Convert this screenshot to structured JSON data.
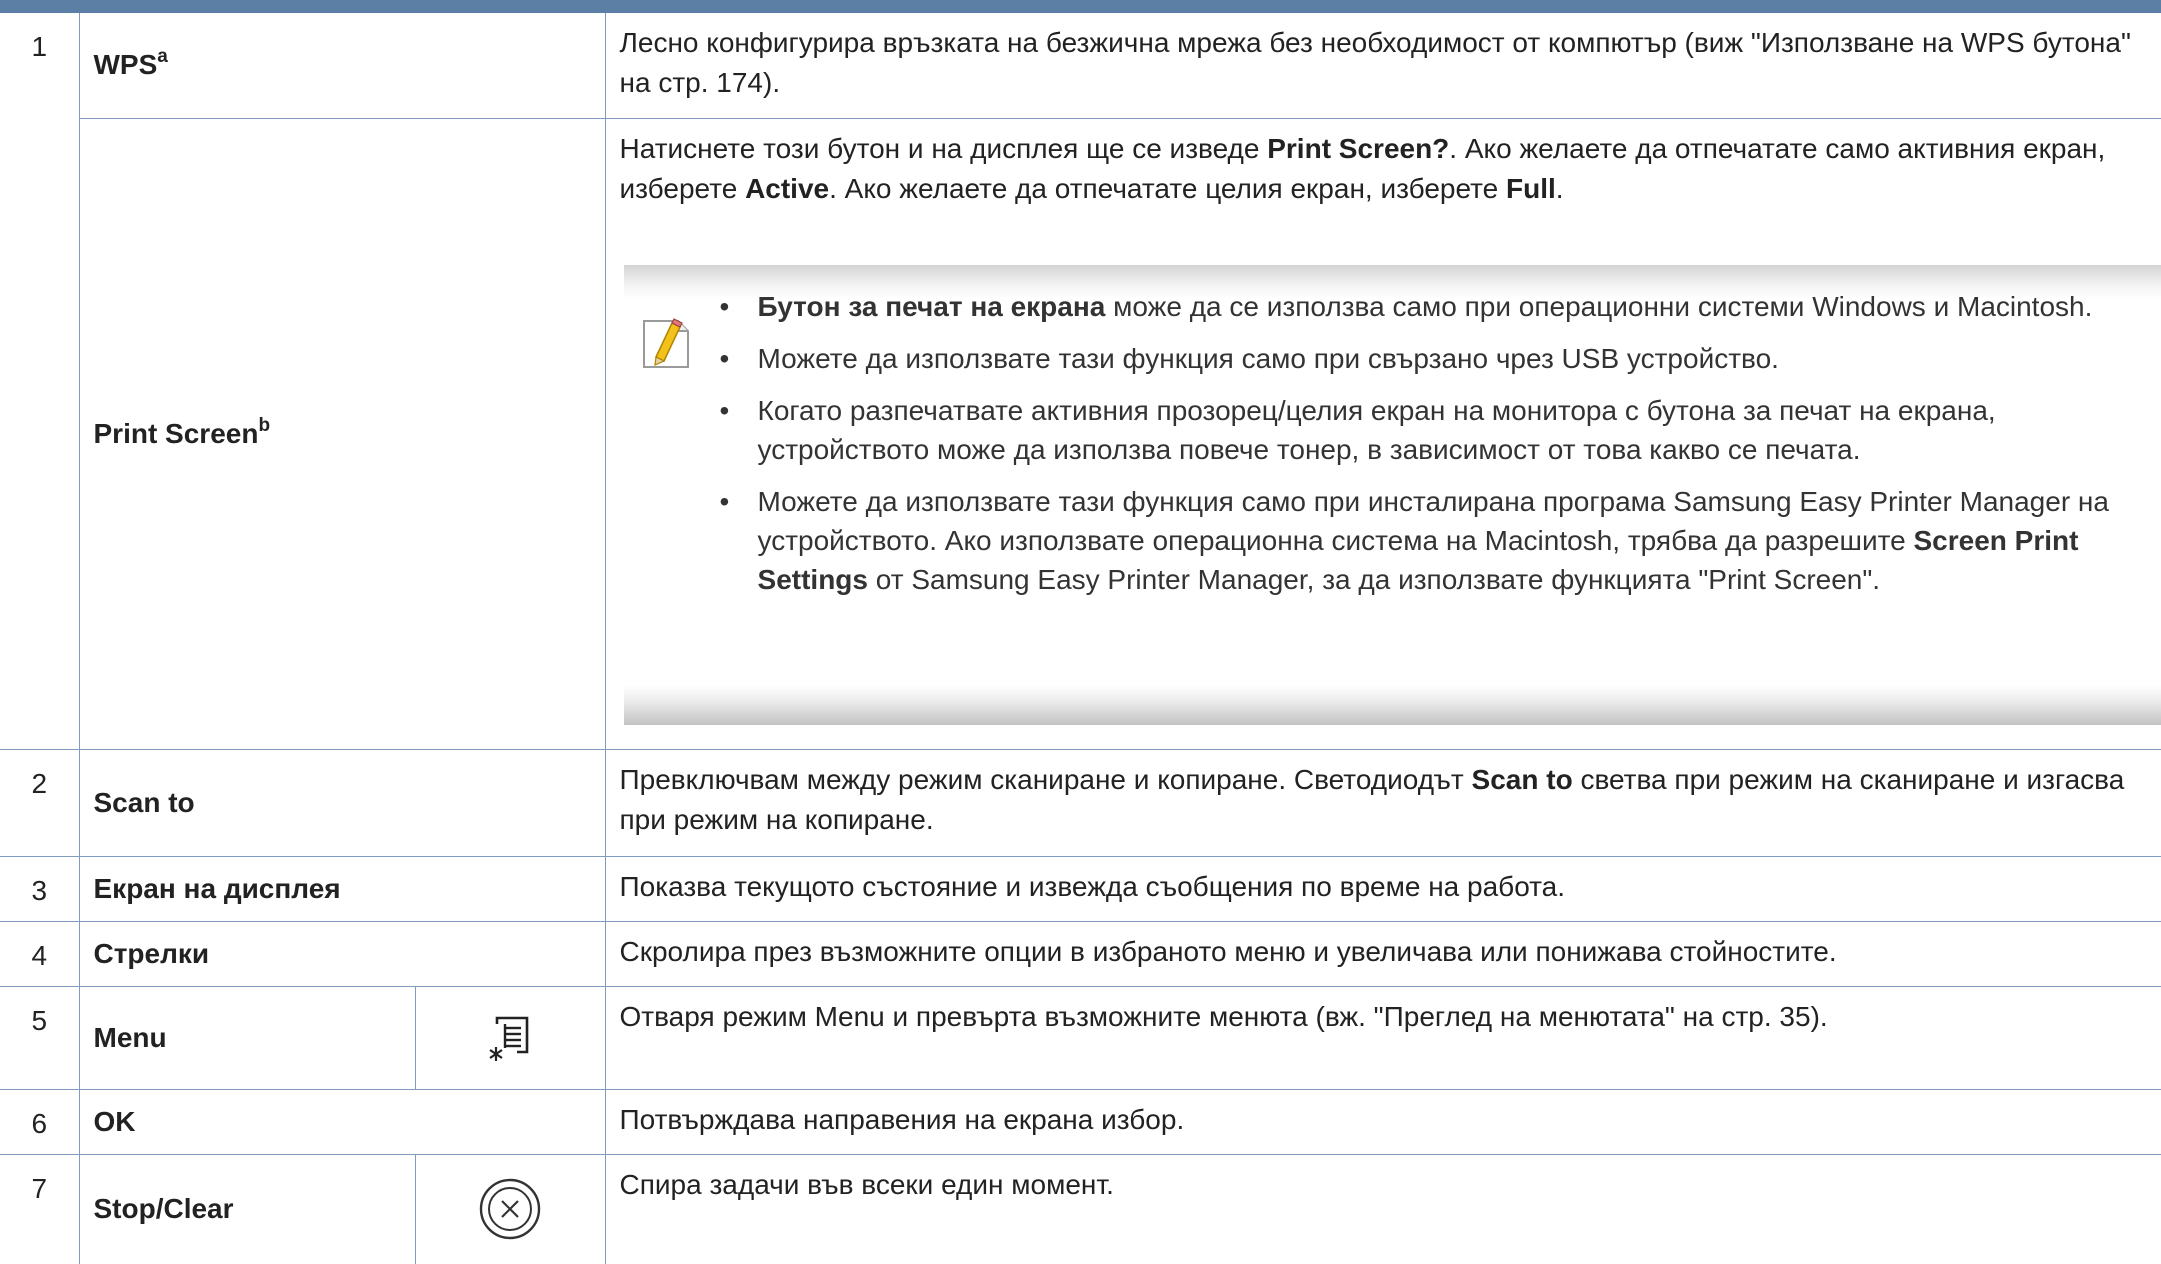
{
  "rows": [
    {
      "num": "1",
      "name": "WPS",
      "sup": "a",
      "desc": [
        "Лесно конфигурира връзката на безжична мрежа без необходимост от компютър (виж \"Използване на WPS бутона\" на стр. 174)."
      ]
    },
    {
      "name": "Print Screen",
      "sup": "b",
      "desc": [
        "Натиснете този бутон и на дисплея ще се изведе ",
        "Print Screen?",
        ". Ако желаете да отпечатате само активния екран, изберете ",
        "Active",
        ". Ако желаете да отпечатате целия екран, изберете ",
        "Full",
        "."
      ],
      "note": {
        "icon": "note-pencil-icon",
        "items": [
          [
            "Бутон за печат на екрана",
            " може да се използва само при операционни системи Windows и Macintosh."
          ],
          [
            "Можете да използвате тази функция само при свързано чрез USB устройство."
          ],
          [
            "Когато разпечатвате активния прозорец/целия екран на монитора с бутона за печат на екрана, устройството може да използва повече тонер, в зависимост от това какво се печата."
          ],
          [
            "Можете да използвате тази функция само при инсталирана програма Samsung Easy Printer Manager на устройството. Ако използвате операционна система на Macintosh, трябва да разрешите ",
            "Screen Print Settings",
            " от Samsung Easy Printer Manager, за да използвате функцията \"Print Screen\"."
          ]
        ]
      }
    },
    {
      "num": "2",
      "name": "Scan to",
      "desc": [
        "Превключвам между режим сканиране и копиране. Светодиодът ",
        "Scan to",
        " светва при режим на сканиране и изгасва при режим на копиране."
      ]
    },
    {
      "num": "3",
      "name": "Екран на дисплея",
      "desc": [
        "Показва текущото състояние и извежда съобщения по време на работа."
      ]
    },
    {
      "num": "4",
      "name": "Стрелки",
      "desc": [
        "Скролира през възможните опции в избраното меню и увеличава или понижава стойностите."
      ]
    },
    {
      "num": "5",
      "name": "Menu",
      "icon": "menu-icon",
      "desc": [
        "Отваря режим Menu и превърта възможните менюта (вж. \"Преглед на менютата\" на стр. 35)."
      ]
    },
    {
      "num": "6",
      "name": "OK",
      "desc": [
        "Потвърждава направения на екрана избор."
      ]
    },
    {
      "num": "7",
      "name": "Stop/Clear",
      "icon": "stop-clear-icon",
      "desc": [
        "Спира задачи във всеки един момент."
      ]
    }
  ],
  "colors": {
    "rule": "#7f9cc0",
    "top_rule": "#5c7fa6",
    "text": "#222222"
  }
}
